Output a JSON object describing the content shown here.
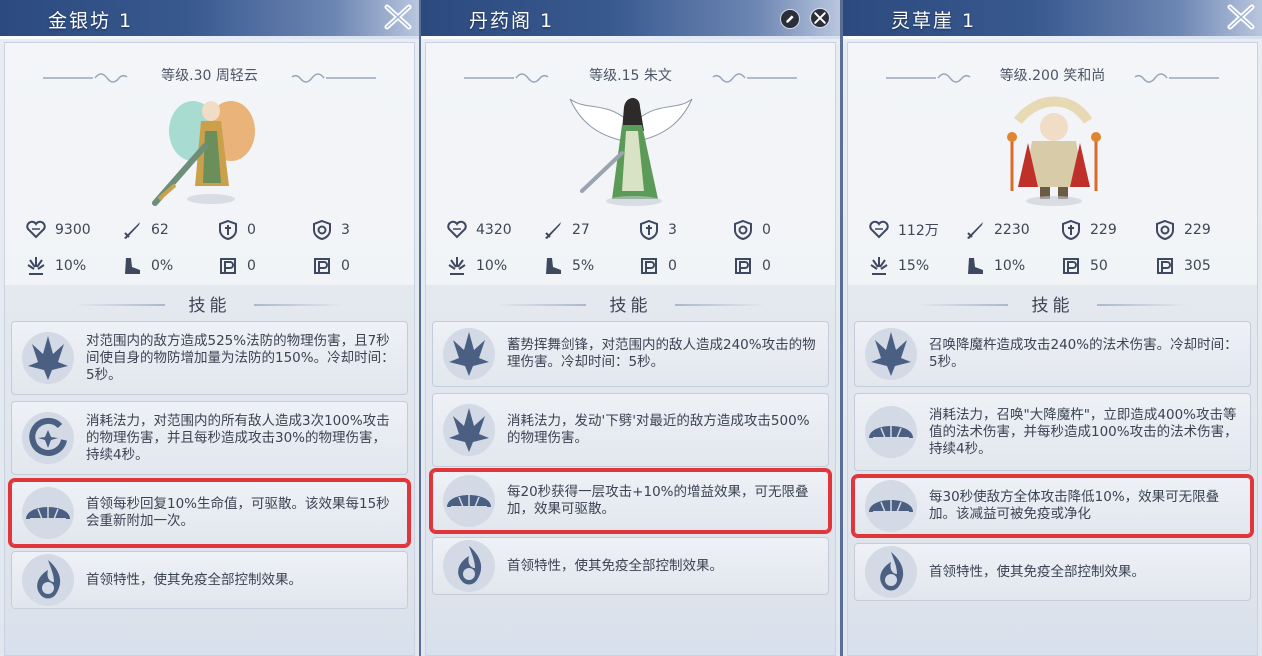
{
  "panels": [
    {
      "title": "金银坊 1",
      "level_text": "等级.30 周轻云",
      "portrait_icon": "fairy-swordswoman-portrait",
      "stats": [
        "9300",
        "62",
        "0",
        "3",
        "10%",
        "0%",
        "0",
        "0"
      ],
      "skills_heading": "技能",
      "skills": [
        {
          "icon": "spiky-crest-icon",
          "text": "对范围内的敌方造成525%法防的物理伤害，且7秒间使自身的物防增加量为法防的150%。冷却时间：5秒。"
        },
        {
          "icon": "swirl-crest-icon",
          "text": "消耗法力，对范围内的所有敌人造成3次100%攻击的物理伤害，并且每秒造成攻击30%的物理伤害，持续4秒。"
        },
        {
          "icon": "turtle-shell-icon",
          "text": "首领每秒回复10%生命值，可驱散。该效果每15秒会重新附加一次。"
        },
        {
          "icon": "flame-emblem-icon",
          "text": "首领特性，使其免疫全部控制效果。"
        }
      ]
    },
    {
      "title": "丹药阁 1",
      "level_text": "等级.15 朱文",
      "portrait_icon": "winged-warrior-portrait",
      "stats": [
        "4320",
        "27",
        "3",
        "0",
        "10%",
        "5%",
        "0",
        "0"
      ],
      "skills_heading": "技能",
      "skills": [
        {
          "icon": "spiky-crest-icon",
          "text": "蓄势挥舞剑锋，对范围内的敌人造成240%攻击的物理伤害。冷却时间：5秒。"
        },
        {
          "icon": "spiky-crest-icon",
          "text": "消耗法力，发动'下劈'对最近的敌方造成攻击500%的物理伤害。"
        },
        {
          "icon": "turtle-shell-icon",
          "text": "每20秒获得一层攻击+10%的增益效果，可无限叠加，效果可驱散。"
        },
        {
          "icon": "flame-emblem-icon",
          "text": "首领特性，使其免疫全部控制效果。"
        }
      ]
    },
    {
      "title": "灵草崖 1",
      "level_text": "等级.200 笑和尚",
      "portrait_icon": "monk-portrait",
      "stats": [
        "112万",
        "2230",
        "229",
        "229",
        "15%",
        "10%",
        "50",
        "305"
      ],
      "skills_heading": "技能",
      "skills": [
        {
          "icon": "spiky-crest-icon",
          "text": "召唤降魔杵造成攻击240%的法术伤害。冷却时间：5秒。"
        },
        {
          "icon": "turtle-shell-icon",
          "text": "消耗法力，召唤\"大降魔杵\"，立即造成400%攻击等值的法术伤害，并每秒造成100%攻击的法术伤害，持续4秒。"
        },
        {
          "icon": "turtle-shell-icon",
          "text": "每30秒使敌方全体攻击降低10%，效果可无限叠加。该减益可被免疫或净化"
        },
        {
          "icon": "flame-emblem-icon",
          "text": "首领特性，使其免疫全部控制效果。"
        }
      ]
    }
  ],
  "stat_icons": [
    "heart-hp-icon",
    "sword-attack-icon",
    "shield-physical-defense-icon",
    "shield-magic-defense-icon",
    "crit-burst-icon",
    "dodge-boot-icon",
    "penetration-p-icon",
    "resistance-p-icon"
  ],
  "colors": {
    "title_bar": "#2c4a7e",
    "highlight_border": "#e0353a",
    "panel_bg": "#eef1f5",
    "text": "#3b4252"
  }
}
